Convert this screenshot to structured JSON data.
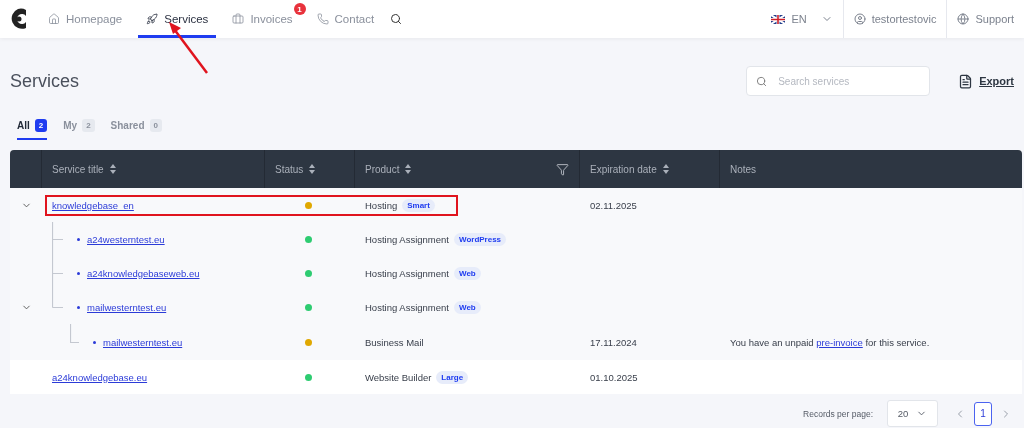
{
  "nav": {
    "items": [
      {
        "label": "Homepage",
        "selected": false
      },
      {
        "label": "Services",
        "selected": true
      },
      {
        "label": "Invoices",
        "selected": false,
        "badge": "1"
      },
      {
        "label": "Contact",
        "selected": false
      }
    ],
    "language": "EN",
    "user": "testortestovic",
    "support": "Support"
  },
  "page": {
    "title": "Services",
    "search": {
      "placeholder": "Search services"
    },
    "export": "Export"
  },
  "tabs": [
    {
      "label": "All",
      "count": "2",
      "selected": true
    },
    {
      "label": "My",
      "count": "2",
      "selected": false
    },
    {
      "label": "Shared",
      "count": "0",
      "selected": false
    }
  ],
  "table": {
    "columns": [
      {
        "label": "Service title",
        "sortable": true
      },
      {
        "label": "Status",
        "sortable": true
      },
      {
        "label": "Product",
        "sortable": true,
        "filter": true
      },
      {
        "label": "Expiration date",
        "sortable": true
      },
      {
        "label": "Notes",
        "sortable": false
      }
    ],
    "rows": [
      {
        "title": "knowledgebase_en",
        "color": "#e0a800",
        "product": "Hosting",
        "tag": "Smart",
        "expiration": "02.11.2025",
        "expanded": true,
        "children": [
          {
            "title": "a24westerntest.eu",
            "color": "#2ecc71",
            "product": "Hosting Assignment",
            "tag": "WordPress"
          },
          {
            "title": "a24knowledgebaseweb.eu",
            "color": "#2ecc71",
            "product": "Hosting Assignment",
            "tag": "Web"
          },
          {
            "title": "mailwesterntest.eu",
            "color": "#2ecc71",
            "product": "Hosting Assignment",
            "tag": "Web",
            "expanded": true,
            "children": [
              {
                "title": "mailwesterntest.eu",
                "color": "#e0a800",
                "product": "Business Mail",
                "expiration": "17.11.2024",
                "note": {
                  "before": "You have an unpaid",
                  "link": "pre-invoice",
                  "after": "for this service."
                }
              }
            ]
          }
        ]
      },
      {
        "title": "a24knowledgebase.eu",
        "color": "#2ecc71",
        "product": "Website Builder",
        "tag": "Large",
        "expiration": "01.10.2025"
      }
    ]
  },
  "pagination": {
    "records_label": "Records per page:",
    "per_page": "20",
    "pages": [
      {
        "label": "1",
        "selected": true
      }
    ]
  }
}
